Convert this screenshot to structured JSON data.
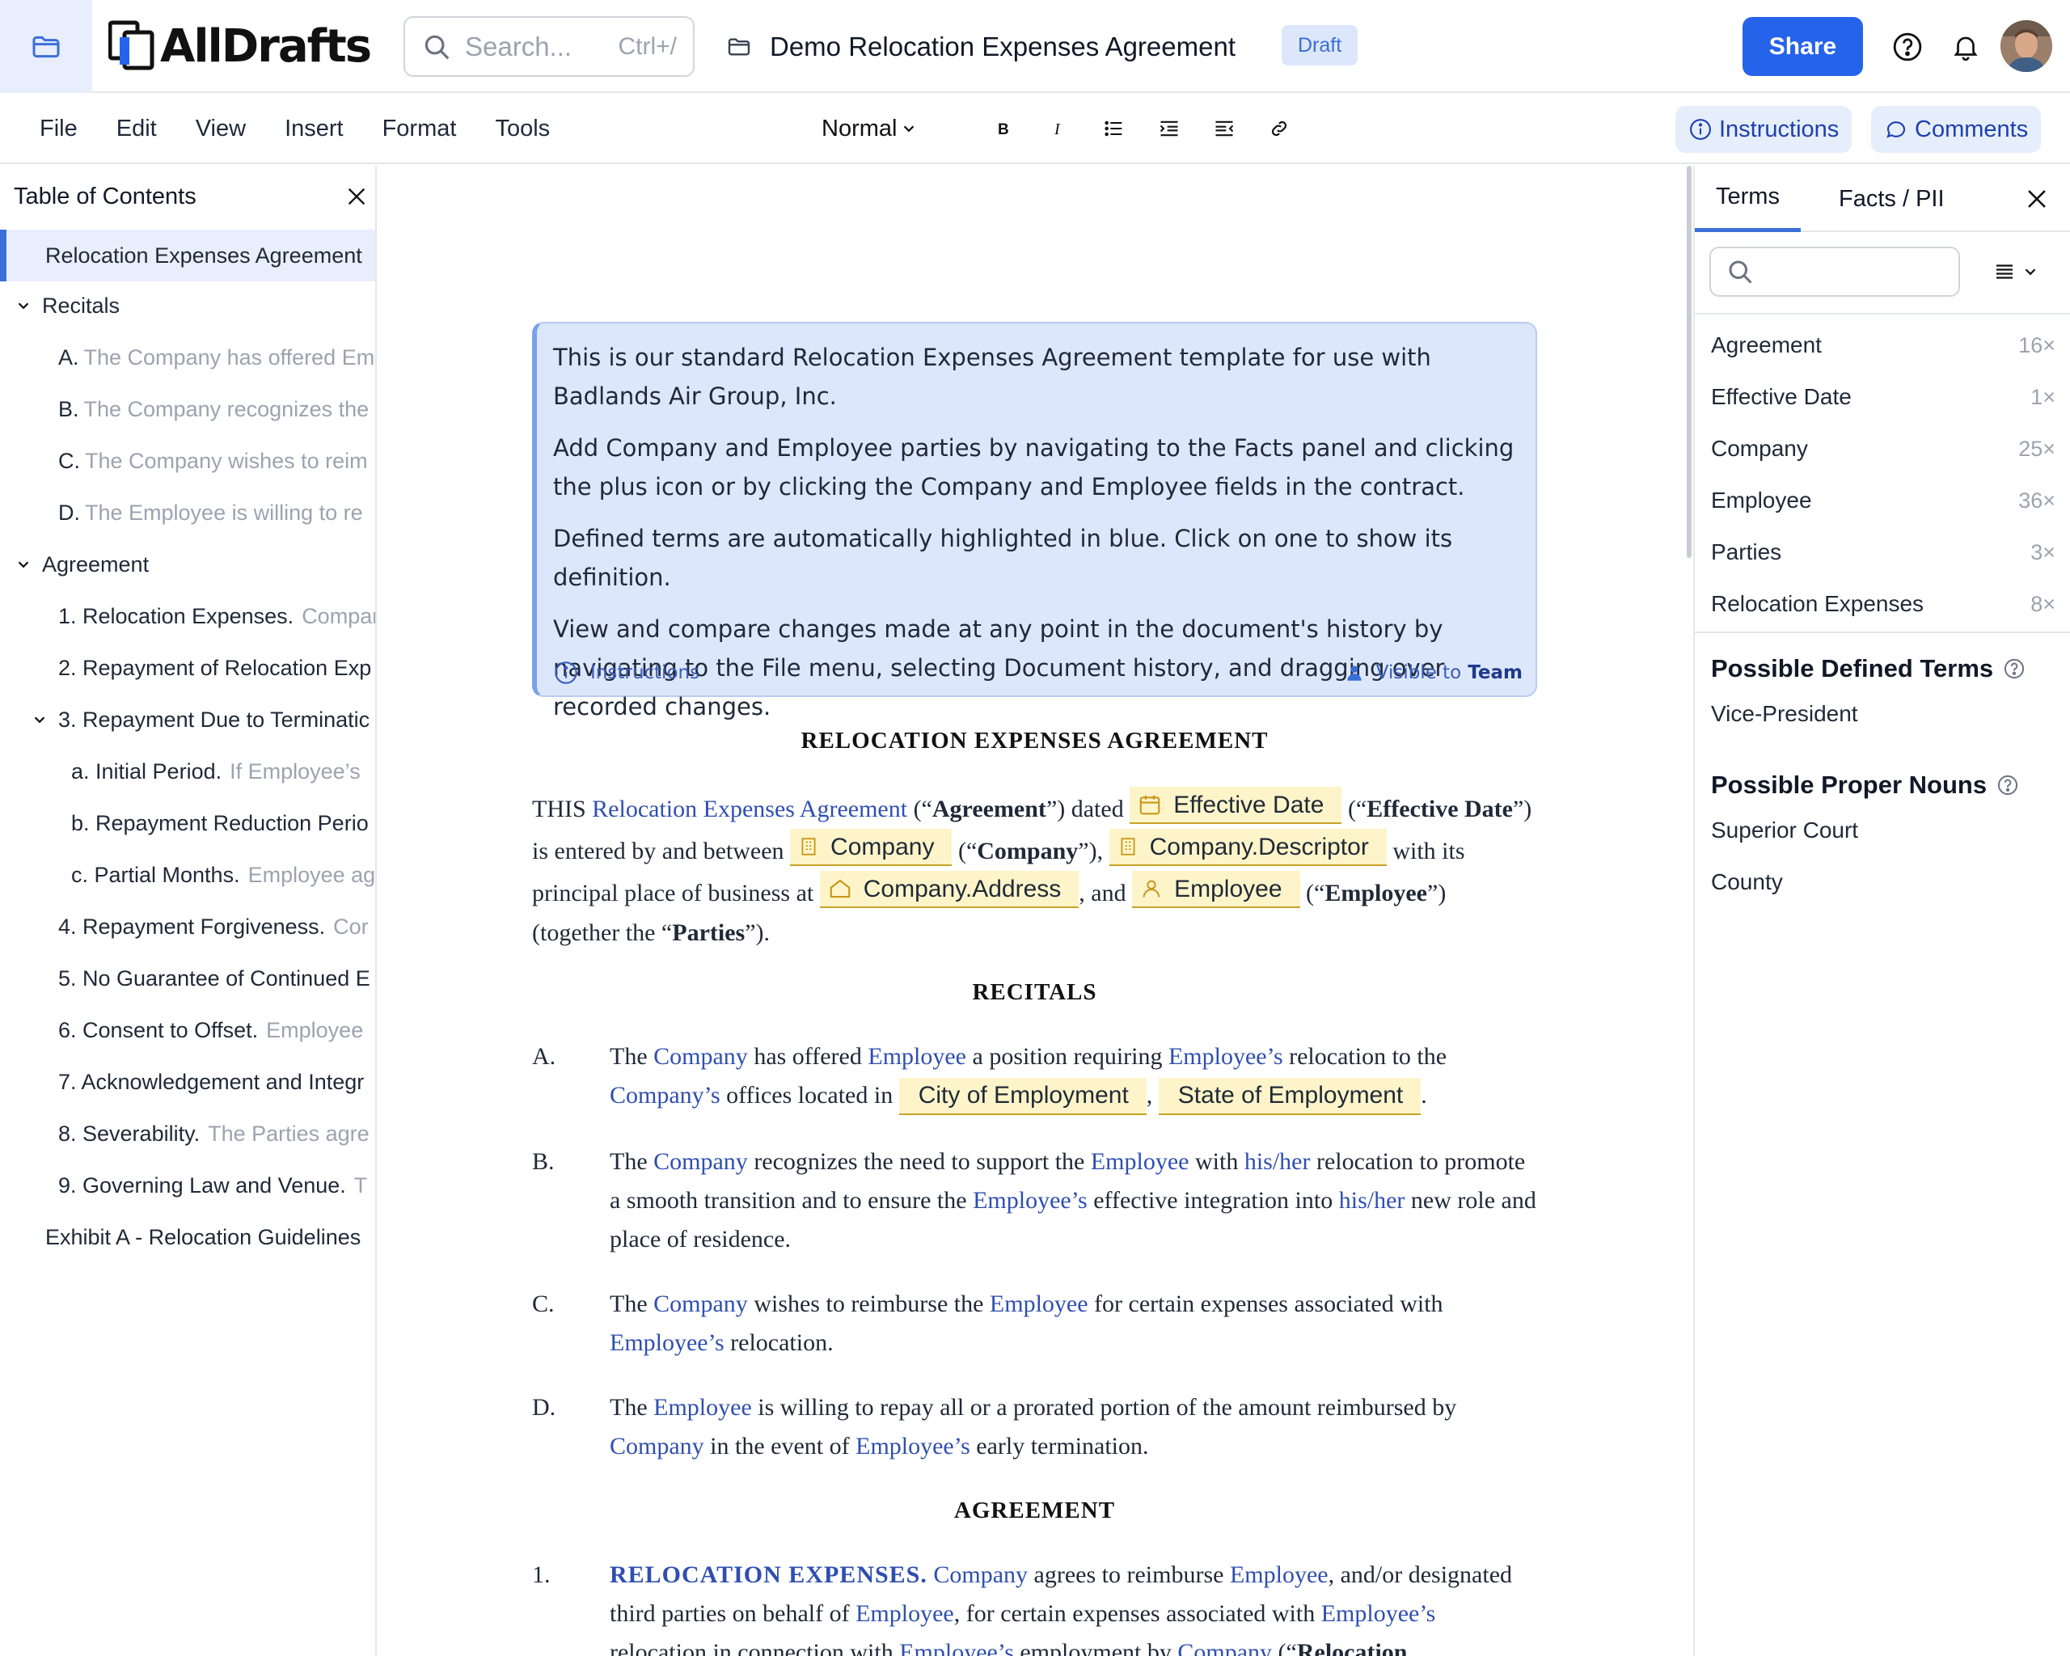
{
  "header": {
    "logo_text": "AllDrafts",
    "search_placeholder": "Search...",
    "search_shortcut": "Ctrl+/",
    "document_title": "Demo Relocation Expenses Agreement",
    "status_badge": "Draft",
    "share_label": "Share"
  },
  "toolbar": {
    "menu": [
      "File",
      "Edit",
      "View",
      "Insert",
      "Format",
      "Tools"
    ],
    "style_select": "Normal",
    "instructions_label": "Instructions",
    "comments_label": "Comments"
  },
  "toc": {
    "title": "Table of Contents",
    "items": [
      {
        "label": "Relocation Expenses Agreement",
        "extra": ""
      },
      {
        "label": "Recitals",
        "extra": ""
      },
      {
        "label": "A.",
        "extra": "The Company has offered Em"
      },
      {
        "label": "B.",
        "extra": "The Company recognizes the"
      },
      {
        "label": "C.",
        "extra": "The Company wishes to reim"
      },
      {
        "label": "D.",
        "extra": "The Employee is willing to re"
      },
      {
        "label": "Agreement",
        "extra": ""
      },
      {
        "label": "1. Relocation Expenses.",
        "extra": "Company"
      },
      {
        "label": "2. Repayment of Relocation Exp",
        "extra": ""
      },
      {
        "label": "3. Repayment Due to Terminatic",
        "extra": ""
      },
      {
        "label": "a. Initial Period.",
        "extra": "If Employee’s"
      },
      {
        "label": "b. Repayment Reduction Perio",
        "extra": ""
      },
      {
        "label": "c. Partial Months.",
        "extra": "Employee ag"
      },
      {
        "label": "4. Repayment Forgiveness.",
        "extra": "Cor"
      },
      {
        "label": "5. No Guarantee of Continued E",
        "extra": ""
      },
      {
        "label": "6. Consent to Offset.",
        "extra": "Employee"
      },
      {
        "label": "7. Acknowledgement and Integr",
        "extra": ""
      },
      {
        "label": "8. Severability.",
        "extra": "The Parties agre"
      },
      {
        "label": "9. Governing Law and Venue.",
        "extra": "T"
      },
      {
        "label": "Exhibit A - Relocation Guidelines",
        "extra": ""
      }
    ]
  },
  "instructions_box": {
    "paragraphs": [
      "This is our standard Relocation Expenses Agreement template for use with Badlands Air Group, Inc.",
      "Add Company and Employee parties by navigating to the Facts panel and clicking the plus icon or by clicking the Company and Employee fields in the contract.",
      "Defined terms are automatically highlighted in blue. Click on one to show its definition.",
      "View and compare changes made at any point in the document's history by navigating to the File menu, selecting Document history, and dragging over recorded changes."
    ],
    "footer_label": "Instructions",
    "visibility_prefix": "Visible to",
    "visibility_target": "Team"
  },
  "document": {
    "title": "RELOCATION EXPENSES AGREEMENT",
    "preamble": {
      "t1": "THIS ",
      "defined_agreement": "Relocation Expenses Agreement",
      "t2": " (“",
      "agreement_b": "Agreement",
      "t3": "”) dated ",
      "field_effective_date": "Effective Date",
      "t4": " (“",
      "effective_b": "Effective Date",
      "t5": "”) is entered by and between ",
      "field_company": "Company",
      "t6": " (“",
      "company_b": "Company",
      "t7": "”), ",
      "field_company_descriptor": "Company.Descriptor",
      "t8": " with its principal place of business at ",
      "field_company_address": "Company.Address",
      "t9": ", and ",
      "field_employee": "Employee",
      "t10": " (“",
      "employee_b": "Employee",
      "t11": "”) (together the “",
      "parties_b": "Parties",
      "t12": "”)."
    },
    "recitals_heading": "RECITALS",
    "recitals": {
      "a": {
        "label": "A.",
        "t1": "The ",
        "d1": "Company",
        "t2": " has offered ",
        "d2": "Employee",
        "t3": " a position requiring ",
        "d3": "Employee’s",
        "t4": " relocation to the ",
        "d4": "Company’s",
        "t5": " offices located in ",
        "field_city": "City of Employment",
        "t6": ", ",
        "field_state": "State of Employment",
        "t7": "."
      },
      "b": {
        "label": "B.",
        "t1": "The ",
        "d1": "Company",
        "t2": " recognizes the need to support the ",
        "d2": "Employee",
        "t3": " with ",
        "d3": "his/her",
        "t4": " relocation to promote a smooth transition and to ensure the ",
        "d4": "Employee’s",
        "t5": " effective integration into ",
        "d5": "his/her",
        "t6": " new role and place of residence."
      },
      "c": {
        "label": "C.",
        "t1": "The ",
        "d1": "Company",
        "t2": " wishes to reimburse the ",
        "d2": "Employee",
        "t3": " for certain expenses associated with ",
        "d3": "Employee’s",
        "t4": " relocation."
      },
      "d": {
        "label": "D.",
        "t1": "The ",
        "d1": "Employee",
        "t2": " is willing to repay all or a prorated portion of the amount reimbursed by ",
        "d2": "Company",
        "t3": " in the event of ",
        "d3": "Employee’s",
        "t4": " early termination."
      }
    },
    "agreement_heading": "AGREEMENT",
    "section1": {
      "label": "1.",
      "heading": "RELOCATION EXPENSES.",
      "t1": " ",
      "d1": "Company",
      "t2": " agrees to reimburse ",
      "d2": "Employee",
      "t3": ", and/or designated third parties on behalf of ",
      "d3": "Employee",
      "t4": ", for certain expenses associated with ",
      "d4": "Employee’s",
      "t5": " relocation in connection with ",
      "d5": "Employee’s",
      "t6": " employment by ",
      "d6": "Company",
      "t7": " (“",
      "t8": "Relocation"
    }
  },
  "right_panel": {
    "tabs": [
      "Terms",
      "Facts / PII"
    ],
    "terms": [
      {
        "name": "Agreement",
        "count": "16×"
      },
      {
        "name": "Effective Date",
        "count": "1×"
      },
      {
        "name": "Company",
        "count": "25×"
      },
      {
        "name": "Employee",
        "count": "36×"
      },
      {
        "name": "Parties",
        "count": "3×"
      },
      {
        "name": "Relocation Expenses",
        "count": "8×"
      }
    ],
    "possible_defined_terms_heading": "Possible Defined Terms",
    "possible_defined_terms": [
      "Vice-President"
    ],
    "possible_proper_nouns_heading": "Possible Proper Nouns",
    "possible_proper_nouns": [
      "Superior Court",
      "County"
    ]
  },
  "colors": {
    "accent": "#2563eb",
    "defined_term": "#2f4fb0",
    "field_fill": "#fdf5c9",
    "instructions_fill": "#dde7fb"
  }
}
